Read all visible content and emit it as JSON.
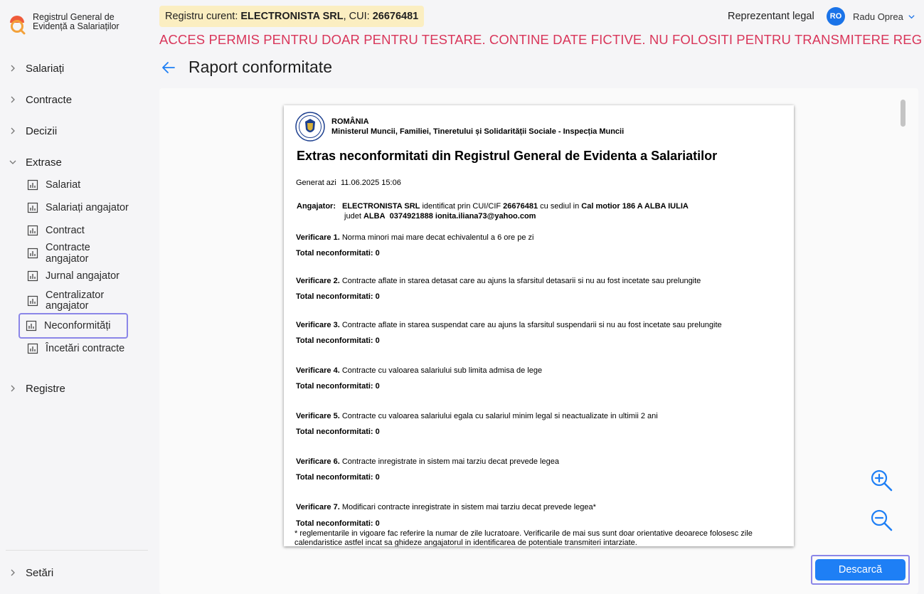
{
  "brand": {
    "title_line1": "Registrul General de",
    "title_line2": "Evidență a Salariaților"
  },
  "sidebar": {
    "sections": [
      {
        "label": "Salariați",
        "expanded": false
      },
      {
        "label": "Contracte",
        "expanded": false
      },
      {
        "label": "Decizii",
        "expanded": false
      },
      {
        "label": "Extrase",
        "expanded": true
      },
      {
        "label": "Registre",
        "expanded": false
      }
    ],
    "extrase_items": [
      {
        "label": "Salariat"
      },
      {
        "label": "Salariați angajator"
      },
      {
        "label": "Contract"
      },
      {
        "label": "Contracte angajator"
      },
      {
        "label": "Jurnal angajator"
      },
      {
        "label": "Centralizator angajator"
      },
      {
        "label": "Neconformități",
        "active": true
      },
      {
        "label": "Încetări contracte"
      }
    ],
    "settings_label": "Setări"
  },
  "header": {
    "registru_prefix": "Registru curent: ",
    "registru_name": "ELECTRONISTA SRL",
    "registru_cui_prefix": ", CUI: ",
    "registru_cui": "26676481",
    "role": "Reprezentant legal",
    "avatar_initials": "RO",
    "user_name": "Radu Oprea",
    "warning": "ACCES PERMIS PENTRU DOAR PENTRU TESTARE. CONTINE DATE FICTIVE. NU FOLOSITI PENTRU TRANSMITERE REGISTRU"
  },
  "page": {
    "title": "Raport conformitate"
  },
  "document": {
    "country": "ROMÂNIA",
    "ministry": "Ministerul Muncii, Familiei, Tineretului și Solidarității Sociale - Inspecția Muncii",
    "title": "Extras neconformitati din Registrul General de Evidenta a Salariatilor",
    "generated_label": "Generat azi",
    "generated_at": "11.06.2025 15:06",
    "employer_label": "Angajator:",
    "employer_name": "ELECTRONISTA SRL",
    "employer_mid1": " identificat prin CUI/CIF ",
    "employer_cui": "26676481",
    "employer_mid2": " cu sediul in ",
    "employer_address": "Cal motior 186 A ALBA IULIA",
    "employer_mid3": " judet ",
    "employer_county": "ALBA",
    "employer_phone": "0374921888",
    "employer_email": "ionita.iliana73@yahoo.com",
    "checks": [
      {
        "label": "Verificare 1.",
        "text": "Norma minori mai mare decat echivalentul a 6 ore pe zi",
        "total": "Total neconformitati: 0"
      },
      {
        "label": "Verificare 2.",
        "text": "Contracte aflate in starea detasat care au ajuns la sfarsitul detasarii si nu au fost incetate sau prelungite",
        "total": "Total neconformitati: 0"
      },
      {
        "label": "Verificare 3.",
        "text": "Contracte aflate in starea suspendat care au ajuns la sfarsitul suspendarii si nu au fost incetate sau prelungite",
        "total": "Total neconformitati: 0"
      },
      {
        "label": "Verificare 4.",
        "text": "Contracte cu valoarea salariului sub limita admisa de lege",
        "total": "Total neconformitati: 0"
      },
      {
        "label": "Verificare 5.",
        "text": "Contracte cu valoarea salariului egala cu salariul minim legal si neactualizate in ultimii 2 ani",
        "total": "Total neconformitati: 0"
      },
      {
        "label": "Verificare 6.",
        "text": "Contracte inregistrate in sistem mai tarziu decat prevede legea",
        "total": "Total neconformitati: 0"
      },
      {
        "label": "Verificare 7.",
        "text": "Modificari contracte inregistrate in sistem mai tarziu decat prevede legea*",
        "total": "Total neconformitati: 0"
      }
    ],
    "note": "* reglementarile in vigoare fac referire la numar de zile lucratoare. Verificarile de mai sus sunt doar orientative deoarece folosesc zile calendaristice astfel incat sa ghideze angajatorul in identificarea de potentiale transmiteri intarziate."
  },
  "actions": {
    "download_label": "Descarcă"
  },
  "colors": {
    "accent": "#1e7ff5",
    "warning": "#d9365a",
    "badge_bg": "#fbeec1",
    "focus_outline": "#8b86e8"
  }
}
